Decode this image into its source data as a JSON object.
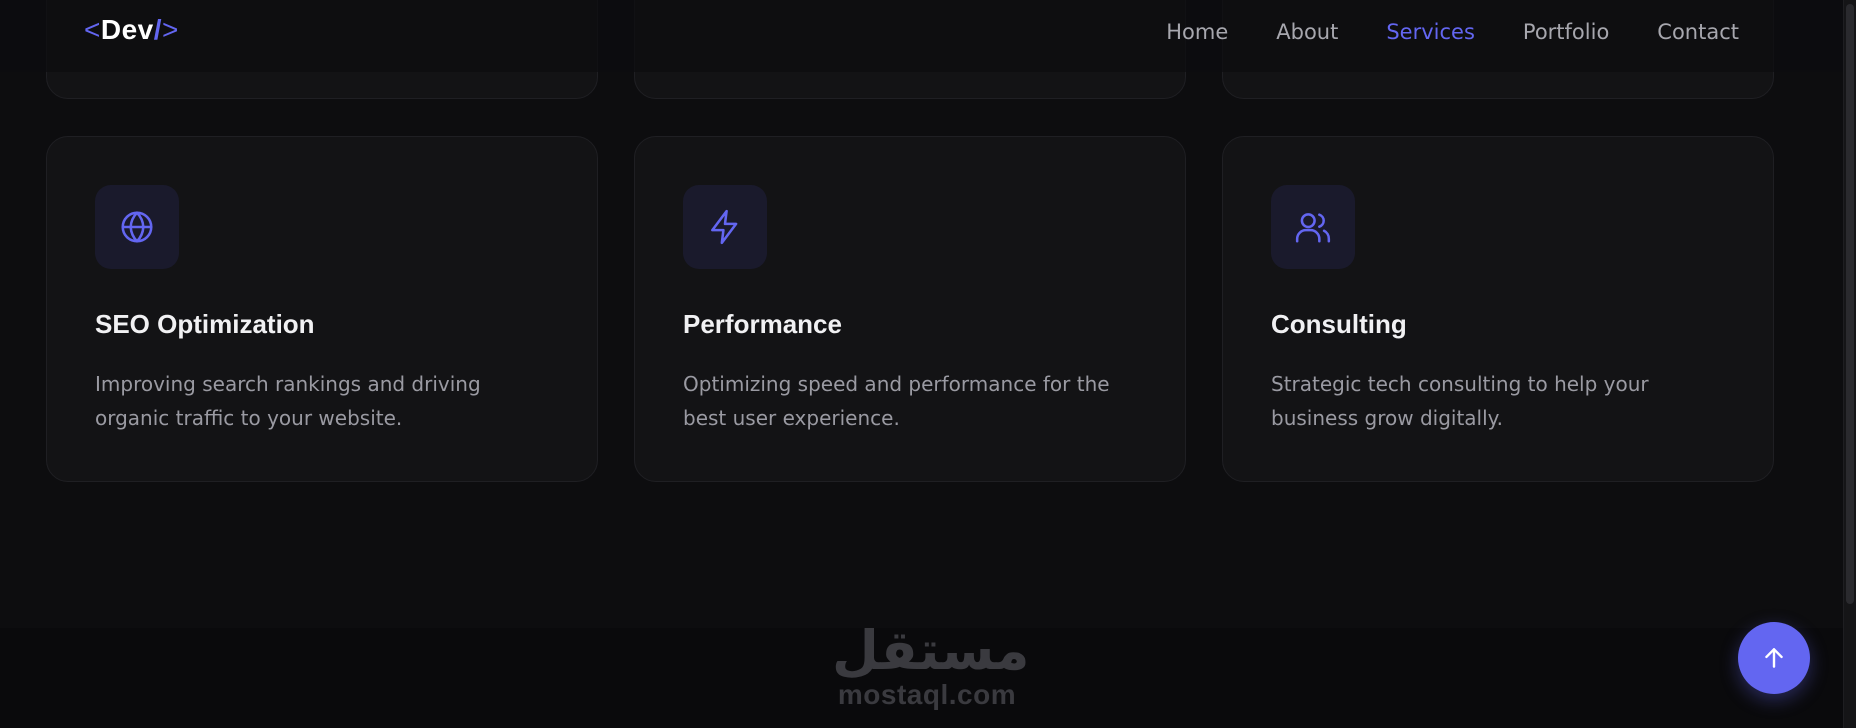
{
  "header": {
    "logo": {
      "open": "<",
      "name": "Dev",
      "slash": "/",
      "close": ">"
    },
    "nav": [
      "Home",
      "About",
      "Services",
      "Portfolio",
      "Contact"
    ],
    "active": "Services"
  },
  "services": [
    {
      "icon": "globe-icon",
      "title": "SEO Optimization",
      "description": "Improving search rankings and driving organic traffic to your website."
    },
    {
      "icon": "lightning-icon",
      "title": "Performance",
      "description": "Optimizing speed and performance for the best user experience."
    },
    {
      "icon": "users-icon",
      "title": "Consulting",
      "description": "Strategic tech consulting to help your business grow digitally."
    }
  ],
  "watermark": {
    "arabic": "مستقل",
    "latin": "mostaql.com"
  },
  "scroll_top": {
    "icon": "arrow-up-icon"
  },
  "colors": {
    "accent": "#6366f1",
    "background": "#0d0d0f",
    "card": "#131315",
    "text": "#f1f1f3",
    "muted": "#9a9aa2"
  }
}
